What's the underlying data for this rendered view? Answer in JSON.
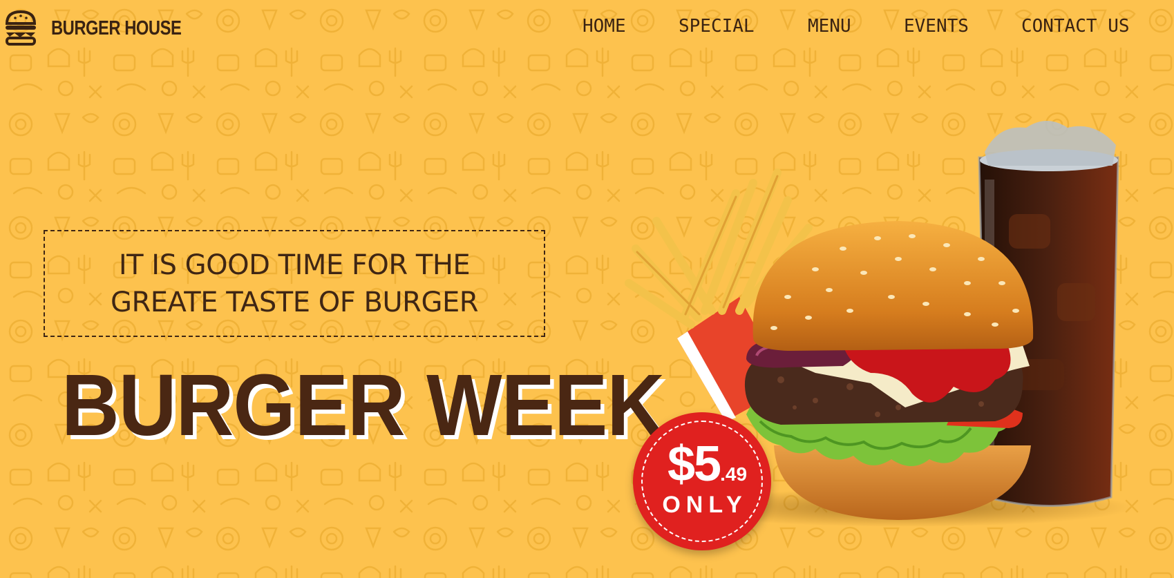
{
  "brand": {
    "name": "BURGER HOUSE",
    "icon": "burger-icon"
  },
  "nav": {
    "items": [
      {
        "label": "HOME"
      },
      {
        "label": "SPECIAL"
      },
      {
        "label": "MENU"
      },
      {
        "label": "EVENTS"
      },
      {
        "label": "CONTACT US"
      }
    ]
  },
  "hero": {
    "tagline_line1": "IT IS GOOD TIME FOR THE",
    "tagline_line2": "GREATE TASTE OF BURGER",
    "headline": "BURGER WEEK",
    "price": {
      "dollars": "$5",
      "cents": ".49",
      "suffix": "ONLY"
    }
  },
  "colors": {
    "background": "#FDC24E",
    "text_dark": "#3F2614",
    "badge": "#E0211F",
    "headline": "#4A2713"
  }
}
